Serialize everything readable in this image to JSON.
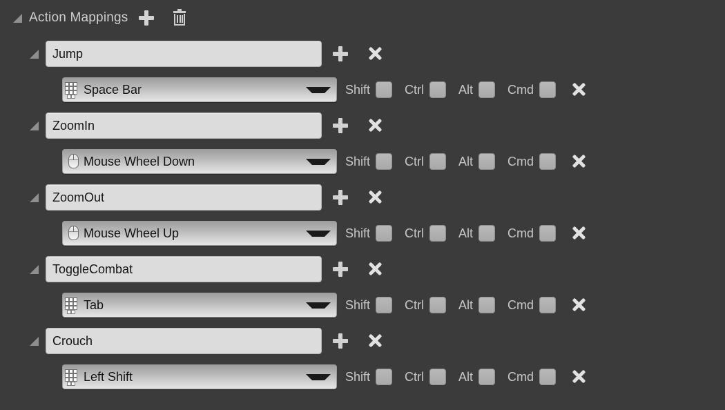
{
  "section": {
    "title": "Action Mappings",
    "expander_icon": "expander-triangle-expanded",
    "add_icon": "plus-icon",
    "delete_icon": "trash-icon"
  },
  "modifiers": {
    "shift_label": "Shift",
    "ctrl_label": "Ctrl",
    "alt_label": "Alt",
    "cmd_label": "Cmd"
  },
  "icons": {
    "keyboard": "keyboard-icon",
    "mouse": "mouse-icon",
    "dropdown_arrow": "chevron-down-icon",
    "add": "plus-icon",
    "remove": "x-icon"
  },
  "colors": {
    "background": "#3b3b3b",
    "field_bg": "#dcdcdc",
    "label_text": "#c7c7c7",
    "value_text": "#101010",
    "checkbox": "#b0b0b0"
  },
  "mappings": [
    {
      "name": "Jump",
      "key": "Space Bar",
      "key_device": "keyboard",
      "shift": false,
      "ctrl": false,
      "alt": false,
      "cmd": false
    },
    {
      "name": "ZoomIn",
      "key": "Mouse Wheel Down",
      "key_device": "mouse",
      "shift": false,
      "ctrl": false,
      "alt": false,
      "cmd": false
    },
    {
      "name": "ZoomOut",
      "key": "Mouse Wheel Up",
      "key_device": "mouse",
      "shift": false,
      "ctrl": false,
      "alt": false,
      "cmd": false
    },
    {
      "name": "ToggleCombat",
      "key": "Tab",
      "key_device": "keyboard",
      "shift": false,
      "ctrl": false,
      "alt": false,
      "cmd": false
    },
    {
      "name": "Crouch",
      "key": "Left Shift",
      "key_device": "keyboard",
      "shift": false,
      "ctrl": false,
      "alt": false,
      "cmd": false
    }
  ]
}
